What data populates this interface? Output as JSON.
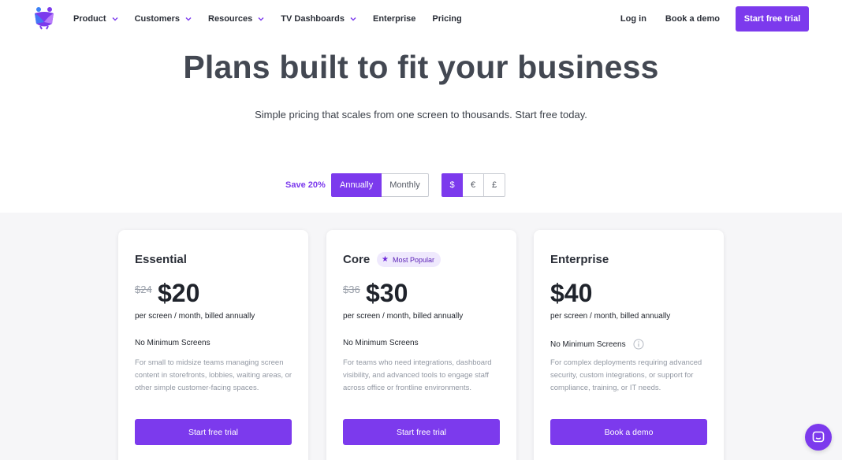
{
  "nav": {
    "items": [
      {
        "label": "Product",
        "has_dropdown": true
      },
      {
        "label": "Customers",
        "has_dropdown": true
      },
      {
        "label": "Resources",
        "has_dropdown": true
      },
      {
        "label": "TV Dashboards",
        "has_dropdown": true
      },
      {
        "label": "Enterprise",
        "has_dropdown": false
      },
      {
        "label": "Pricing",
        "has_dropdown": false
      }
    ],
    "login": "Log in",
    "book_demo": "Book a demo",
    "cta": "Start free trial"
  },
  "hero": {
    "title": "Plans built to fit your business",
    "subtitle": "Simple pricing that scales from one screen to thousands. Start free today."
  },
  "billing": {
    "save_label": "Save 20%",
    "options": [
      "Annually",
      "Monthly"
    ],
    "selected": "Annually"
  },
  "currency": {
    "options": [
      "$",
      "€",
      "£"
    ],
    "selected": "$"
  },
  "plans": [
    {
      "name": "Essential",
      "badge": "",
      "old_price": "$24",
      "price": "$20",
      "period": "per screen / month, billed annually",
      "minimum": "No Minimum Screens",
      "description": "For small to midsize teams managing screen content in storefronts, lobbies, waiting areas, or other simple customer-facing spaces.",
      "button": "Start free trial"
    },
    {
      "name": "Core",
      "badge": "Most Popular",
      "old_price": "$36",
      "price": "$30",
      "period": "per screen / month, billed annually",
      "minimum": "No Minimum Screens",
      "description": "For teams who need integrations, dashboard visibility, and advanced tools to engage staff across office or frontline environments.",
      "button": "Start free trial"
    },
    {
      "name": "Enterprise",
      "badge": "",
      "old_price": "",
      "price": "$40",
      "period": "per screen / month, billed annually",
      "minimum": "No Minimum Screens",
      "description": "For complex deployments requiring advanced security, custom integrations, or support for compliance, training, or IT needs.",
      "button": "Book a demo"
    }
  ],
  "icons": {
    "logo": "logo-icon",
    "chevron": "chevron-down-icon",
    "info": "info-icon",
    "star": "star-icon",
    "chat": "chat-icon"
  },
  "colors": {
    "accent": "#7c3aed",
    "badge_bg": "#efe9fd",
    "headline": "#434852",
    "background": "#f6f6f8"
  }
}
